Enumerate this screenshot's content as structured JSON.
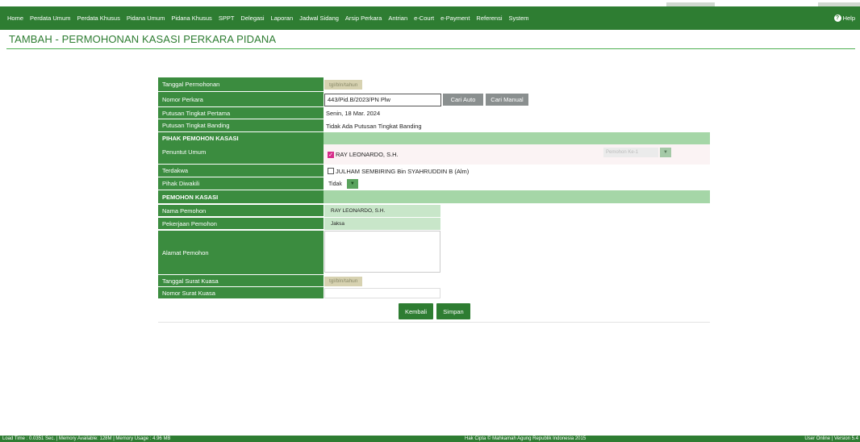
{
  "nav": {
    "items": [
      "Home",
      "Perdata Umum",
      "Perdata Khusus",
      "Pidana Umum",
      "Pidana Khusus",
      "SPPT",
      "Delegasi",
      "Laporan",
      "Jadwal Sidang",
      "Arsip Perkara",
      "Antrian",
      "e-Court",
      "e-Payment",
      "Referensi",
      "System"
    ],
    "help": "Help",
    "bg_color": "#2e7d32"
  },
  "page": {
    "title": "TAMBAH - PERMOHONAN KASASI PERKARA PIDANA"
  },
  "form": {
    "tanggal_permohonan": {
      "label": "Tanggal Permohonan",
      "placeholder": "tgl/bln/tahun"
    },
    "nomor_perkara": {
      "label": "Nomor Perkara",
      "value": "443/Pid.B/2023/PN Plw",
      "cari_auto": "Cari Auto",
      "cari_manual": "Cari Manual"
    },
    "putusan_pertama": {
      "label": "Putusan Tingkat Pertama",
      "value": "Senin, 18 Mar. 2024"
    },
    "putusan_banding": {
      "label": "Putusan Tingkat Banding",
      "value": "Tidak Ada Putusan Tingkat Banding"
    },
    "section_pihak": "PIHAK PEMOHON KASASI",
    "penuntut_umum": {
      "label": "Penuntut Umum",
      "value": "RAY LEONARDO, S.H.",
      "checked": true,
      "select_placeholder": "Pemohon Ke-1"
    },
    "terdakwa": {
      "label": "Terdakwa",
      "value": "JULHAM SEMBIRING Bin SYAHRUDDIN B (Alm)",
      "checked": false
    },
    "pihak_diwakili": {
      "label": "Pihak Diwakili",
      "value": "Tidak"
    },
    "section_pemohon": "PEMOHON KASASI",
    "nama_pemohon": {
      "label": "Nama Pemohon",
      "value": "RAY LEONARDO, S.H."
    },
    "pekerjaan_pemohon": {
      "label": "Pekerjaan Pemohon",
      "value": "Jaksa"
    },
    "alamat_pemohon": {
      "label": "Alamat Pemohon",
      "value": ""
    },
    "tanggal_surat_kuasa": {
      "label": "Tanggal Surat Kuasa",
      "placeholder": "tgl/bln/tahun"
    },
    "nomor_surat_kuasa": {
      "label": "Nomor Surat Kuasa",
      "value": ""
    }
  },
  "actions": {
    "kembali": "Kembali",
    "simpan": "Simpan"
  },
  "footer": {
    "left": "Load Time : 0.0351 Sec. | Memory Available: 128M | Memory Usage : 4.96 MB",
    "center": "Hak Cipta © Mahkamah Agung Republik Indonesia 2015",
    "right": "User Online | Version 5.4"
  }
}
